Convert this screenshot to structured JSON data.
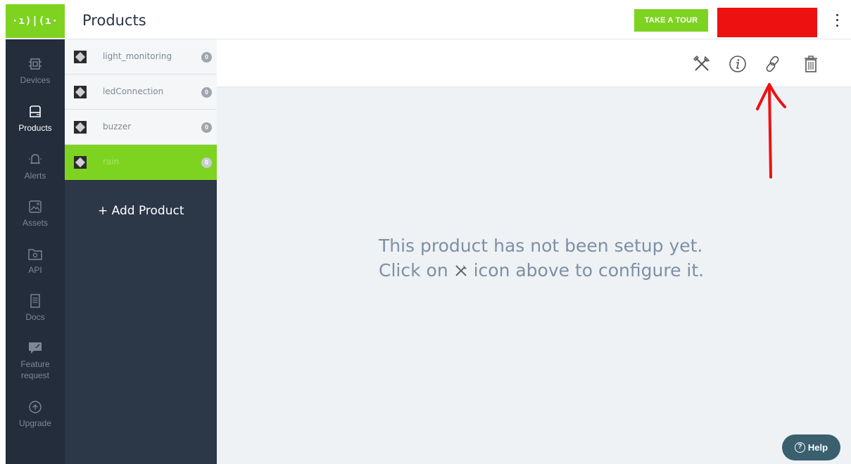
{
  "header": {
    "logo_text": "·ı)|(ı·",
    "title": "Products",
    "tour_button": "TAKE A TOUR"
  },
  "nav": {
    "items": [
      {
        "label": "Devices",
        "icon": "chip-icon"
      },
      {
        "label": "Products",
        "icon": "product-box-icon",
        "active": true
      },
      {
        "label": "Alerts",
        "icon": "bell-icon"
      },
      {
        "label": "Assets",
        "icon": "image-icon"
      },
      {
        "label": "API",
        "icon": "api-folder-icon"
      },
      {
        "label": "Docs",
        "icon": "document-icon"
      },
      {
        "label": "Feature request",
        "icon": "chat-icon"
      },
      {
        "label": "Upgrade",
        "icon": "upgrade-arrow-icon"
      }
    ]
  },
  "products": {
    "items": [
      {
        "name": "light_monitoring",
        "count": "0"
      },
      {
        "name": "ledConnection",
        "count": "0"
      },
      {
        "name": "buzzer",
        "count": "0"
      },
      {
        "name": "rain",
        "count": "0",
        "selected": true
      }
    ],
    "add_label": "+ Add Product"
  },
  "main": {
    "message_line1": "This product has not been setup yet.",
    "message_line2_pre": "Click on",
    "message_line2_post": "icon above to configure it."
  },
  "help": {
    "label": "Help"
  },
  "colors": {
    "accent": "#7ed321",
    "nav_bg": "#232d3c",
    "list_bg": "#2c3748",
    "annotation_red": "#ee1111",
    "help_bg": "#3a5f6f"
  }
}
